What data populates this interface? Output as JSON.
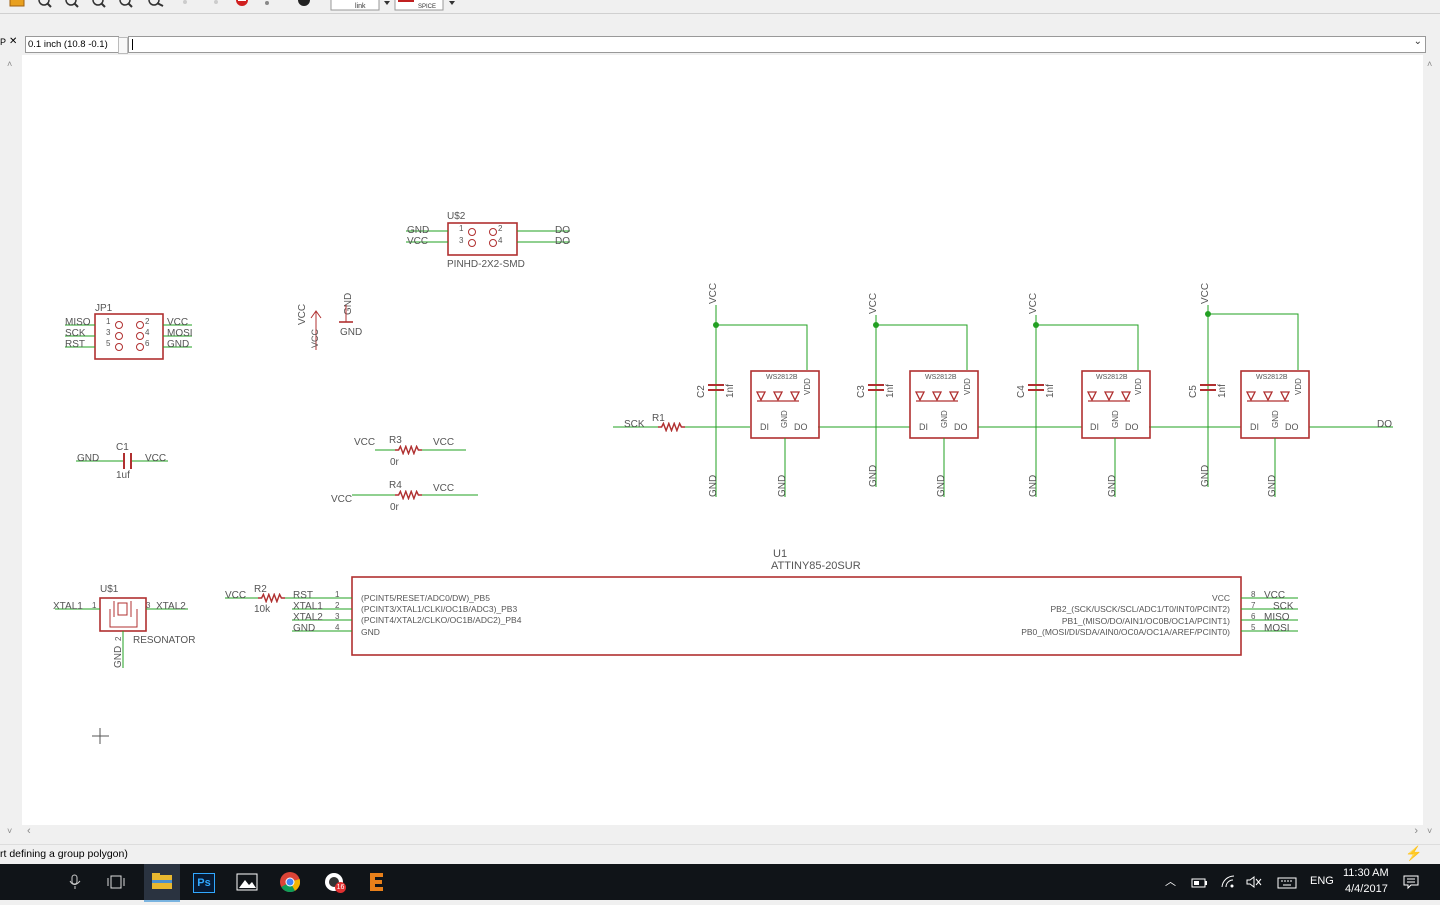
{
  "toolbar": {
    "link_label": "link",
    "spice_label": "SPICE",
    "icons": [
      "folder-icon",
      "zoom-fit-icon",
      "zoom-in-icon",
      "zoom-out-icon",
      "zoom-select-icon",
      "redraw-icon",
      "undo-icon",
      "redo-icon",
      "stop-icon",
      "go-icon",
      "help-icon"
    ]
  },
  "command": {
    "coordinate": "0.1 inch (10.8 -0.1)",
    "input_value": "",
    "left_label": "P"
  },
  "status": {
    "message": "rt defining a group polygon)"
  },
  "schematic": {
    "colors": {
      "part": "#b03030",
      "wire": "#22a022",
      "text": "#555555",
      "junction": "#22a022"
    },
    "header": {
      "ref": "U$2",
      "pkg": "PINHD-2X2-SMD",
      "left": [
        "GND",
        "VCC"
      ],
      "right": [
        "DO",
        "DO"
      ],
      "pins": [
        "1",
        "2",
        "3",
        "4"
      ]
    },
    "jp1": {
      "ref": "JP1",
      "left": [
        "MISO",
        "SCK",
        "RST"
      ],
      "right": [
        "VCC",
        "MOSI",
        "GND"
      ],
      "pins_l": [
        "1",
        "3",
        "5"
      ],
      "pins_r": [
        "2",
        "4",
        "6"
      ]
    },
    "supply_labels": {
      "vcc": "VCC",
      "gnd": "GND"
    },
    "c1": {
      "ref": "C1",
      "value": "1uf",
      "left": "GND",
      "right": "VCC"
    },
    "r3": {
      "ref": "R3",
      "value": "0r",
      "left": "VCC",
      "right": "VCC"
    },
    "r4": {
      "ref": "R4",
      "value": "0r",
      "left": "VCC",
      "right": "VCC"
    },
    "leds": [
      {
        "cap": "C2",
        "value": "1nf",
        "chip": "WS2812B"
      },
      {
        "cap": "C3",
        "value": "1nf",
        "chip": "WS2812B"
      },
      {
        "cap": "C4",
        "value": "1nf",
        "chip": "WS2812B"
      },
      {
        "cap": "C5",
        "value": "1nf",
        "chip": "WS2812B"
      }
    ],
    "led_pins": {
      "di": "DI",
      "do": "DO",
      "gnd": "GND",
      "vdd": "VDD"
    },
    "r1": {
      "ref": "R1",
      "net_in": "SCK",
      "net_out": "DO"
    },
    "u1": {
      "ref": "U1",
      "part": "ATTINY85-20SUR",
      "left_pins": [
        {
          "num": "1",
          "net": "RST",
          "name": "(PCINT5/RESET/ADC0/DW)_PB5"
        },
        {
          "num": "2",
          "net": "XTAL1",
          "name": "(PCINT3/XTAL1/CLKI/OC1B/ADC3)_PB3"
        },
        {
          "num": "3",
          "net": "XTAL2",
          "name": "(PCINT4/XTAL2/CLKO/OC1B/ADC2)_PB4"
        },
        {
          "num": "4",
          "net": "GND",
          "name": "GND"
        }
      ],
      "right_pins": [
        {
          "num": "8",
          "net": "VCC",
          "name": "VCC"
        },
        {
          "num": "7",
          "net": "SCK",
          "name": "PB2_(SCK/USCK/SCL/ADC1/T0/INT0/PCINT2)"
        },
        {
          "num": "6",
          "net": "MISO",
          "name": "PB1_(MISO/DO/AIN1/OC0B/OC1A/PCINT1)"
        },
        {
          "num": "5",
          "net": "MOSI",
          "name": "PB0_(MOSI/DI/SDA/AIN0/OC0A/OC1A/AREF/PCINT0)"
        }
      ]
    },
    "r2": {
      "ref": "R2",
      "value": "10k",
      "net": "VCC"
    },
    "resonator": {
      "ref": "U$1",
      "label": "RESONATOR",
      "left": "XTAL1",
      "right": "XTAL2",
      "gnd": "GND",
      "pins": [
        "1",
        "2",
        "3"
      ]
    }
  },
  "taskbar": {
    "lang": "ENG",
    "time": "11:30 AM",
    "date": "4/4/2017",
    "badge": "16",
    "apps": [
      "microphone-icon",
      "task-view-icon",
      "file-explorer-icon",
      "photoshop-icon",
      "photos-icon",
      "chrome-icon",
      "eagle-icon",
      "e-app-icon"
    ]
  }
}
